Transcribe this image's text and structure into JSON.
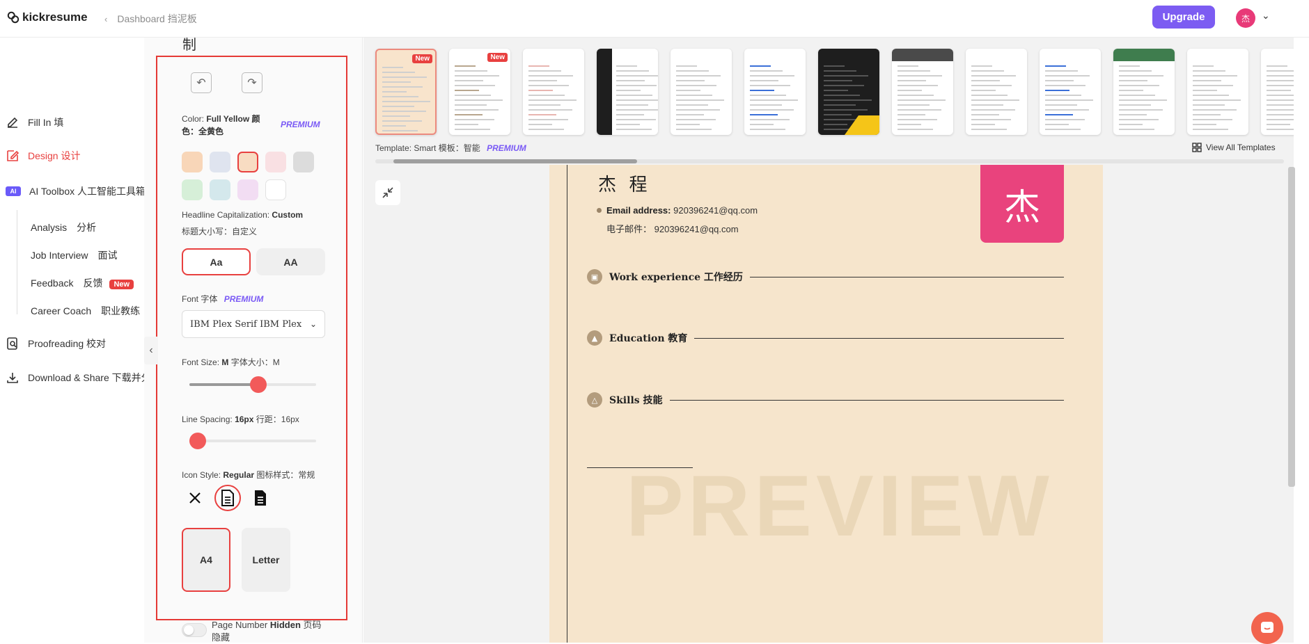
{
  "brand": {
    "name": "kickresume"
  },
  "breadcrumb": {
    "label": "Dashboard 挡泥板"
  },
  "header": {
    "upgrade_label": "Upgrade",
    "avatar_initial": "杰"
  },
  "nav": {
    "fill_in": "Fill In 填",
    "design": "Design 设计",
    "ai_badge": "AI",
    "ai_toolbox": "AI Toolbox 人工智能工具箱",
    "sub": {
      "analysis": "Analysis　分析",
      "job_interview": "Job Interview　面试",
      "feedback": "Feedback　反馈",
      "feedback_badge": "New",
      "career_coach": "Career Coach　职业教练"
    },
    "proofreading": "Proofreading 校对",
    "download": "Download & Share 下载并分享"
  },
  "panel": {
    "title_cut": "制",
    "color": {
      "label": "Color:",
      "value": "Full Yellow 颜色：全黄色",
      "premium": "PREMIUM",
      "swatches": [
        "#f8d6b8",
        "#dfe4ef",
        "#f8dcc2",
        "#f9e0e3",
        "#dcdcdc",
        "#d6efd8",
        "#d4e8ec",
        "#f2ddf3",
        "#ffffff"
      ],
      "selected_index": 2
    },
    "capitalization": {
      "label": "Headline Capitalization:",
      "value": "Custom",
      "subtitle": "标题大小写：自定义",
      "options": [
        "Aa",
        "AA"
      ],
      "selected": "Aa"
    },
    "font": {
      "label": "Font 字体",
      "premium": "PREMIUM",
      "value": "IBM Plex Serif IBM Plex"
    },
    "font_size": {
      "label": "Font Size:",
      "value": "M",
      "suffix": "字体大小：M",
      "level": 0.55
    },
    "line_spacing": {
      "label": "Line Spacing:",
      "value": "16px",
      "suffix": "行距：16px",
      "level": 0.0
    },
    "icon_style": {
      "label": "Icon Style:",
      "value": "Regular",
      "suffix": "图标样式：常规",
      "options": [
        "close-icon",
        "document-outline-icon",
        "document-filled-icon"
      ],
      "selected_index": 1
    },
    "paper": {
      "options": [
        "A4",
        "Letter"
      ],
      "selected": "A4"
    },
    "page_number": {
      "label": "Page Number",
      "value": "Hidden",
      "suffix": "页码隐藏",
      "enabled": false
    }
  },
  "templates": {
    "label": "Template:",
    "value": "Smart 模板：智能",
    "premium": "PREMIUM",
    "view_all": "View All Templates",
    "new_badge": "New",
    "scroll_position": 0.02
  },
  "resume": {
    "name": "杰 程",
    "photo_initial": "杰",
    "email_label": "Email address:",
    "email_value": "920396241@qq.com",
    "email_cn_label": "电子邮件：",
    "email_cn_value": "920396241@qq.com",
    "sections": [
      "Work experience 工作经历",
      "Education 教育",
      "Skills 技能"
    ],
    "watermark": "PREVIEW"
  }
}
